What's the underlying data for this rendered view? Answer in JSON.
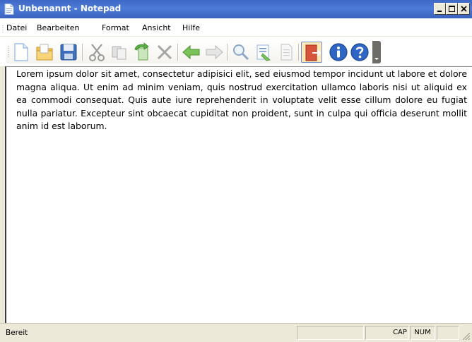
{
  "window": {
    "title": "Unbenannt - Notepad"
  },
  "menu": {
    "items": [
      {
        "label": "Datei"
      },
      {
        "label": "Bearbeiten"
      },
      {
        "label": "Format"
      },
      {
        "label": "Ansicht"
      },
      {
        "label": "Hilfe"
      }
    ]
  },
  "toolbar": {
    "buttons": [
      {
        "icon": "new-document-icon"
      },
      {
        "icon": "open-folder-icon"
      },
      {
        "icon": "save-disk-icon"
      },
      {
        "icon": "cut-scissors-icon"
      },
      {
        "icon": "copy-icon"
      },
      {
        "icon": "paste-icon"
      },
      {
        "icon": "delete-icon"
      },
      {
        "icon": "undo-arrow-icon"
      },
      {
        "icon": "redo-arrow-icon"
      },
      {
        "icon": "find-icon"
      },
      {
        "icon": "replace-icon"
      },
      {
        "icon": "page-setup-icon"
      },
      {
        "icon": "exit-icon",
        "active": true
      },
      {
        "icon": "info-icon"
      },
      {
        "icon": "help-icon"
      }
    ]
  },
  "editor": {
    "content": "Lorem ipsum dolor sit amet, consectetur adipisici elit, sed eiusmod tempor incidunt ut labore et dolore magna aliqua. Ut enim ad minim veniam, quis nostrud exercitation ullamco laboris nisi ut aliquid ex ea commodi consequat. Quis aute iure reprehenderit in voluptate velit esse cillum dolore eu fugiat nulla pariatur. Excepteur sint obcaecat cupiditat non proident, sunt in culpa qui officia deserunt mollit anim id est laborum."
  },
  "statusbar": {
    "status": "Bereit",
    "caps": "CAP",
    "num": "NUM"
  },
  "colors": {
    "titlebar": "#4170cc",
    "editor_bg": "#ffffff",
    "chrome": "#ece9d8"
  }
}
